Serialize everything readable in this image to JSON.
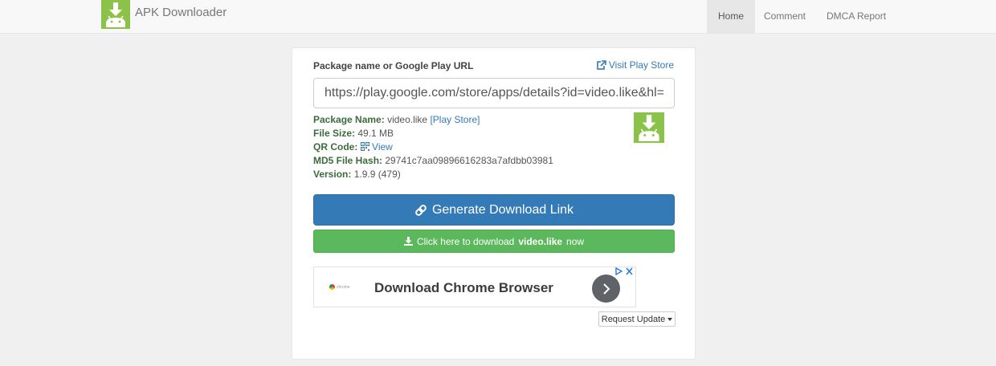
{
  "navbar": {
    "brand": "APK Downloader",
    "items": [
      {
        "label": "Home",
        "active": true
      },
      {
        "label": "Comment",
        "active": false
      },
      {
        "label": "DMCA Report",
        "active": false
      }
    ]
  },
  "form": {
    "label": "Package name or Google Play URL",
    "visit_link": "Visit Play Store",
    "url_value": "https://play.google.com/store/apps/details?id=video.like&hl=zh"
  },
  "info": {
    "package_name_label": "Package Name:",
    "package_name": "video.like",
    "play_store_link": "[Play Store]",
    "file_size_label": "File Size:",
    "file_size": "49.1 MB",
    "qr_code_label": "QR Code:",
    "qr_view": "View",
    "md5_label": "MD5 File Hash:",
    "md5": "29741c7aa09896616283a7afdbb03981",
    "version_label": "Version:",
    "version": "1.9.9 (479)"
  },
  "buttons": {
    "generate": "Generate Download Link",
    "download_prefix": "Click here to download",
    "download_package": "video.like",
    "download_suffix": "now",
    "request_update": "Request Update"
  },
  "ad": {
    "logo_text": "chrome",
    "title": "Download Chrome Browser"
  },
  "colors": {
    "primary": "#337ab7",
    "success": "#5cb85c",
    "android_green": "#8bc34a"
  }
}
